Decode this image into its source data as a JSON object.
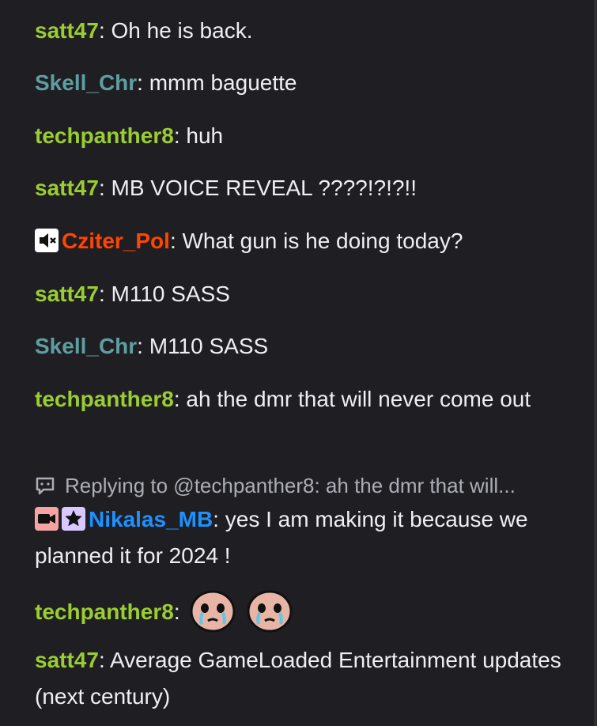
{
  "messages": [
    {
      "user": "satt47",
      "color": "#9acd32",
      "text": "Oh he is back."
    },
    {
      "user": "Skell_Chr",
      "color": "#5f9ea0",
      "text": "mmm baguette"
    },
    {
      "user": "techpanther8",
      "color": "#9acd32",
      "text": "huh"
    },
    {
      "user": "satt47",
      "color": "#9acd32",
      "text": "MB VOICE REVEAL ????!?!?!!"
    },
    {
      "user": "Cziter_Pol",
      "color": "#ff4500",
      "text": "What gun is he doing today?",
      "badges": [
        "muted-speaker-badge"
      ]
    },
    {
      "user": "satt47",
      "color": "#9acd32",
      "text": "M110 SASS"
    },
    {
      "user": "Skell_Chr",
      "color": "#5f9ea0",
      "text": "M110 SASS"
    },
    {
      "user": "techpanther8",
      "color": "#9acd32",
      "text": "ah the dmr that will never come out"
    },
    {
      "user": "Nikalas_MB",
      "color": "#1e90ff",
      "text": "yes I am making it because we planned it for 2024 !",
      "badges": [
        "broadcaster-badge",
        "star-badge"
      ],
      "reply_to": "Replying to @techpanther8: ah the dmr that will..."
    },
    {
      "user": "techpanther8",
      "color": "#9acd32",
      "text": "",
      "emotes": [
        "crying-face-emote",
        "crying-face-emote"
      ]
    },
    {
      "user": "satt47",
      "color": "#9acd32",
      "text": "Average GameLoaded Entertainment updates (next century)"
    }
  ],
  "colon": ":",
  "colors": {
    "background": "#1f1f23",
    "text": "#efeff1",
    "reply_text": "#adadb8"
  }
}
